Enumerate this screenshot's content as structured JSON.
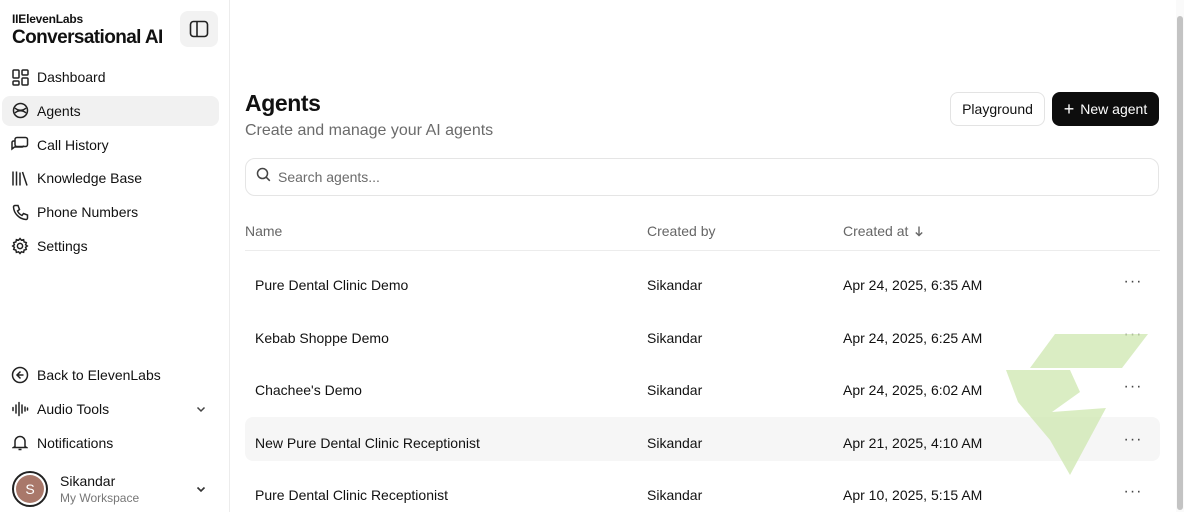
{
  "brand": {
    "small": "IIElevenLabs",
    "big": "Conversational AI"
  },
  "nav": {
    "items": [
      {
        "label": "Dashboard",
        "icon": "dashboard-icon"
      },
      {
        "label": "Agents",
        "icon": "agents-icon",
        "active": true
      },
      {
        "label": "Call History",
        "icon": "call-history-icon"
      },
      {
        "label": "Knowledge Base",
        "icon": "knowledge-base-icon"
      },
      {
        "label": "Phone Numbers",
        "icon": "phone-icon"
      },
      {
        "label": "Settings",
        "icon": "gear-icon"
      }
    ]
  },
  "bottom_nav": {
    "back": "Back to ElevenLabs",
    "audio_tools": "Audio Tools",
    "notifications": "Notifications"
  },
  "user": {
    "initial": "S",
    "name": "Sikandar",
    "workspace": "My Workspace"
  },
  "page": {
    "title": "Agents",
    "subtitle": "Create and manage your AI agents",
    "playground_label": "Playground",
    "new_agent_label": "New agent",
    "search_placeholder": "Search agents..."
  },
  "table": {
    "headers": {
      "name": "Name",
      "created_by": "Created by",
      "created_at": "Created at"
    },
    "rows": [
      {
        "name": "Pure Dental Clinic Demo",
        "created_by": "Sikandar",
        "created_at": "Apr 24, 2025, 6:35 AM"
      },
      {
        "name": "Kebab Shoppe Demo",
        "created_by": "Sikandar",
        "created_at": "Apr 24, 2025, 6:25 AM"
      },
      {
        "name": "Chachee's Demo",
        "created_by": "Sikandar",
        "created_at": "Apr 24, 2025, 6:02 AM"
      },
      {
        "name": "New Pure Dental Clinic Receptionist",
        "created_by": "Sikandar",
        "created_at": "Apr 21, 2025, 4:10 AM"
      },
      {
        "name": "Pure Dental Clinic Receptionist",
        "created_by": "Sikandar",
        "created_at": "Apr 10, 2025, 5:15 AM"
      }
    ],
    "more_glyph": "···"
  },
  "colors": {
    "accent": "#0d0d0d",
    "watermark": "#cfe7b0",
    "active_bg": "#f1f1f1"
  }
}
